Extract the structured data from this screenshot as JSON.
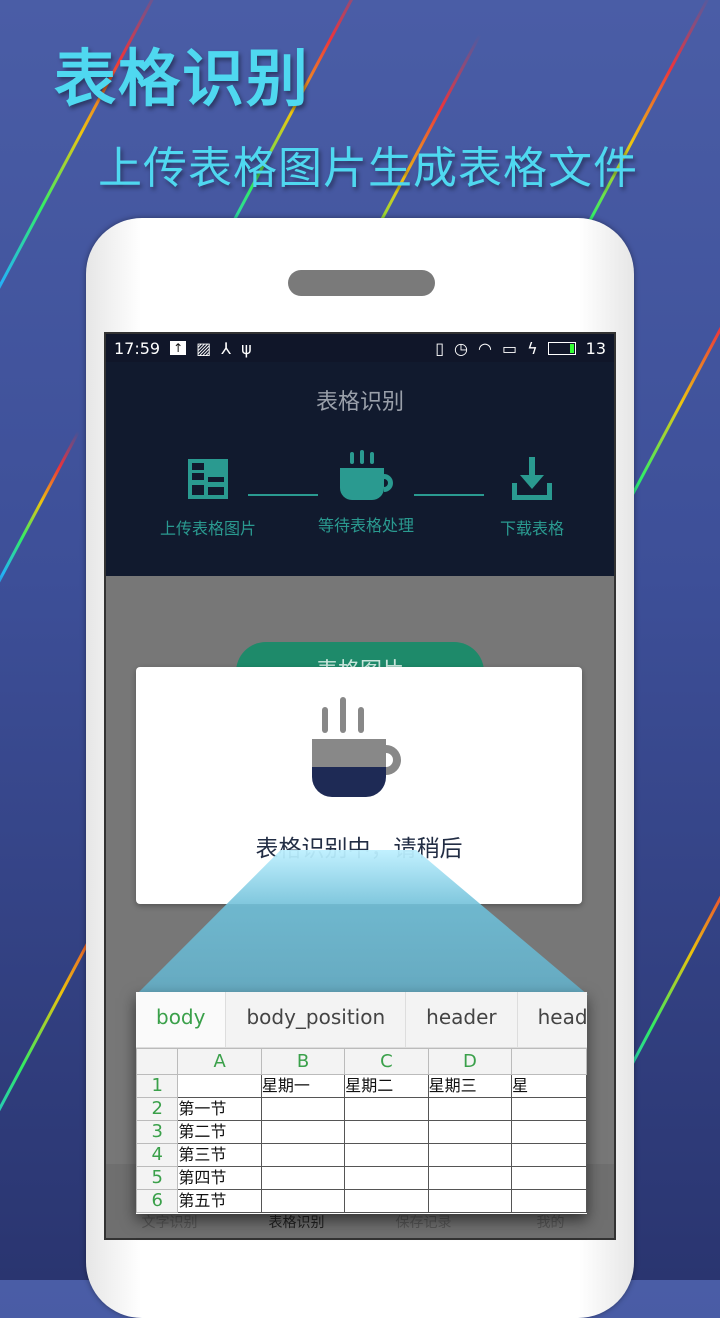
{
  "promo": {
    "title": "表格识别",
    "subtitle": "上传表格图片生成表格文件"
  },
  "status": {
    "time": "17:59",
    "battery": "13",
    "icons_left": [
      "upload-icon",
      "image-icon",
      "share-icon",
      "usb-icon"
    ],
    "icons_right": [
      "vibrate-icon",
      "alarm-icon",
      "wifi-icon",
      "sim-icon",
      "charging-icon",
      "battery-icon"
    ]
  },
  "header": {
    "title": "表格识别",
    "steps": [
      {
        "label": "上传表格图片",
        "icon": "table-icon"
      },
      {
        "label": "等待表格处理",
        "icon": "coffee-cup-icon"
      },
      {
        "label": "下载表格",
        "icon": "download-icon"
      }
    ],
    "accent": "#2a9a90"
  },
  "main": {
    "button_label": "表格图片"
  },
  "dialog": {
    "message": "表格识别中，请稍后"
  },
  "sheet": {
    "tabs": [
      "body",
      "body_position",
      "header",
      "header"
    ],
    "columns": [
      "A",
      "B",
      "C",
      "D",
      ""
    ],
    "rows": [
      [
        "1",
        "",
        "星期一",
        "星期二",
        "星期三",
        "星"
      ],
      [
        "2",
        "第一节",
        "",
        "",
        "",
        ""
      ],
      [
        "3",
        "第二节",
        "",
        "",
        "",
        ""
      ],
      [
        "4",
        "第三节",
        "",
        "",
        "",
        ""
      ],
      [
        "5",
        "第四节",
        "",
        "",
        "",
        ""
      ],
      [
        "6",
        "第五节",
        "",
        "",
        "",
        ""
      ]
    ]
  },
  "tabbar": {
    "items": [
      "文字识别",
      "表格识别",
      "保存记录",
      "我的"
    ]
  }
}
